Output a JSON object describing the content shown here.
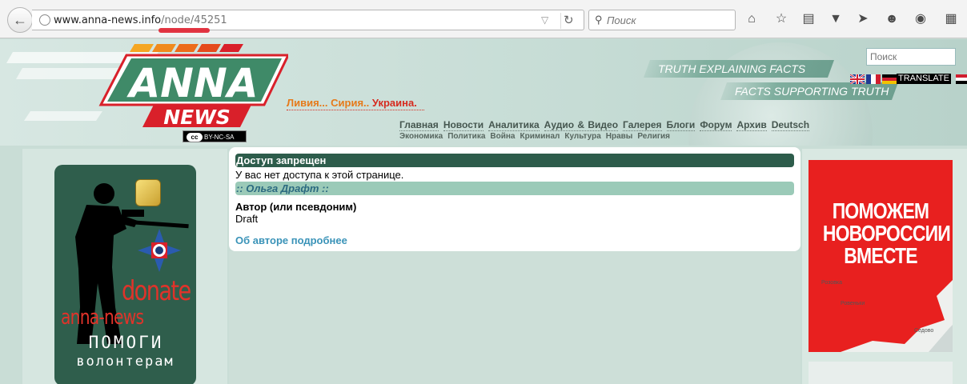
{
  "browser": {
    "url_host": "www.anna-news.info",
    "url_path": "/node/45251",
    "search_placeholder": "Поиск"
  },
  "header": {
    "logo_top": "ANNA",
    "logo_bottom": "NEWS",
    "tagline_orange": "Ливия... Сирия..",
    "tagline_red": "Украина.",
    "cc_label": "BY-NC-SA",
    "banner1": "TRUTH EXPLAINING FACTS",
    "banner2": "FACTS SUPPORTING TRUTH",
    "search_placeholder": "Поиск",
    "translate_label": "TRANSLATE",
    "nav_main": [
      "Главная",
      "Новости",
      "Аналитика",
      "Аудио & Видео",
      "Галерея",
      "Блоги",
      "Форум",
      "Архив",
      "Deutsch"
    ],
    "nav_sub": [
      "Экономика",
      "Политика",
      "Война",
      "Криминал",
      "Культура",
      "Нравы",
      "Религия"
    ]
  },
  "left_banner": {
    "donate": "donate",
    "anna_news": "anna-news",
    "help_line1": "ПОМОГИ",
    "help_line2": "волонтерам"
  },
  "content": {
    "access_title": "Доступ запрещен",
    "access_message": "У вас нет доступа к этой странице.",
    "author_header": ":: Ольга Драфт ::",
    "author_label": "Автор (или псевдоним)",
    "author_value": "Draft",
    "more_link": "Об авторе подробнее"
  },
  "right_banner": {
    "title": "ПОМОЖЕМ НОВОРОССИИ ВМЕСТЕ",
    "map_labels": [
      "Ровеньки",
      "Розовка",
      "Седово"
    ]
  },
  "colors": {
    "dark_bar": "#2d5c4b",
    "light_bar": "#9bcab8",
    "link": "#3a93b8",
    "logo_green": "#3f8a68",
    "logo_red": "#d9202a",
    "page_bg": "#c9ddd6"
  }
}
